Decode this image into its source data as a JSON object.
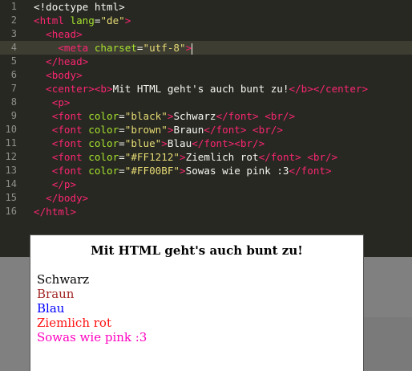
{
  "editor": {
    "lines": [
      {
        "n": "1",
        "segments": [
          {
            "c": "txt",
            "t": "<!doctype html>"
          }
        ]
      },
      {
        "n": "2",
        "segments": [
          {
            "c": "tag",
            "t": "<html "
          },
          {
            "c": "attr",
            "t": "lang"
          },
          {
            "c": "txt",
            "t": "="
          },
          {
            "c": "str",
            "t": "\"de\""
          },
          {
            "c": "tag",
            "t": ">"
          }
        ]
      },
      {
        "n": "3",
        "segments": [
          {
            "c": "txt",
            "t": "  "
          },
          {
            "c": "tag",
            "t": "<head>"
          }
        ]
      },
      {
        "n": "4",
        "segments": [
          {
            "c": "txt",
            "t": "    "
          },
          {
            "c": "tag",
            "t": "<meta "
          },
          {
            "c": "attr",
            "t": "charset"
          },
          {
            "c": "txt",
            "t": "="
          },
          {
            "c": "str",
            "t": "\"utf-8\""
          },
          {
            "c": "tag",
            "t": ">"
          }
        ],
        "active": true
      },
      {
        "n": "5",
        "segments": [
          {
            "c": "txt",
            "t": "  "
          },
          {
            "c": "tag",
            "t": "</head>"
          }
        ]
      },
      {
        "n": "6",
        "segments": [
          {
            "c": "txt",
            "t": "  "
          },
          {
            "c": "tag",
            "t": "<body>"
          }
        ]
      },
      {
        "n": "7",
        "segments": [
          {
            "c": "txt",
            "t": "  "
          },
          {
            "c": "tag",
            "t": "<center>"
          },
          {
            "c": "tag",
            "t": "<b>"
          },
          {
            "c": "txt",
            "t": "Mit HTML geht's auch bunt zu!"
          },
          {
            "c": "tag",
            "t": "</b>"
          },
          {
            "c": "tag",
            "t": "</center>"
          }
        ]
      },
      {
        "n": "8",
        "segments": [
          {
            "c": "txt",
            "t": "   "
          },
          {
            "c": "tag",
            "t": "<p>"
          }
        ]
      },
      {
        "n": "9",
        "segments": [
          {
            "c": "txt",
            "t": "   "
          },
          {
            "c": "tag",
            "t": "<font "
          },
          {
            "c": "attr",
            "t": "color"
          },
          {
            "c": "txt",
            "t": "="
          },
          {
            "c": "str",
            "t": "\"black\""
          },
          {
            "c": "tag",
            "t": ">"
          },
          {
            "c": "txt",
            "t": "Schwarz"
          },
          {
            "c": "tag",
            "t": "</font>"
          },
          {
            "c": "txt",
            "t": " "
          },
          {
            "c": "tag",
            "t": "<br/>"
          }
        ]
      },
      {
        "n": "10",
        "segments": [
          {
            "c": "txt",
            "t": "   "
          },
          {
            "c": "tag",
            "t": "<font "
          },
          {
            "c": "attr",
            "t": "color"
          },
          {
            "c": "txt",
            "t": "="
          },
          {
            "c": "str",
            "t": "\"brown\""
          },
          {
            "c": "tag",
            "t": ">"
          },
          {
            "c": "txt",
            "t": "Braun"
          },
          {
            "c": "tag",
            "t": "</font>"
          },
          {
            "c": "txt",
            "t": " "
          },
          {
            "c": "tag",
            "t": "<br/>"
          }
        ]
      },
      {
        "n": "11",
        "segments": [
          {
            "c": "txt",
            "t": "   "
          },
          {
            "c": "tag",
            "t": "<font "
          },
          {
            "c": "attr",
            "t": "color"
          },
          {
            "c": "txt",
            "t": "="
          },
          {
            "c": "str",
            "t": "\"blue\""
          },
          {
            "c": "tag",
            "t": ">"
          },
          {
            "c": "txt",
            "t": "Blau"
          },
          {
            "c": "tag",
            "t": "</font>"
          },
          {
            "c": "tag",
            "t": "<br/>"
          }
        ]
      },
      {
        "n": "12",
        "segments": [
          {
            "c": "txt",
            "t": "   "
          },
          {
            "c": "tag",
            "t": "<font "
          },
          {
            "c": "attr",
            "t": "color"
          },
          {
            "c": "txt",
            "t": "="
          },
          {
            "c": "str",
            "t": "\"#FF1212\""
          },
          {
            "c": "tag",
            "t": ">"
          },
          {
            "c": "txt",
            "t": "Ziemlich rot"
          },
          {
            "c": "tag",
            "t": "</font>"
          },
          {
            "c": "txt",
            "t": " "
          },
          {
            "c": "tag",
            "t": "<br/>"
          }
        ]
      },
      {
        "n": "13",
        "segments": [
          {
            "c": "txt",
            "t": "   "
          },
          {
            "c": "tag",
            "t": "<font "
          },
          {
            "c": "attr",
            "t": "color"
          },
          {
            "c": "txt",
            "t": "="
          },
          {
            "c": "str",
            "t": "\"#FF00BF\""
          },
          {
            "c": "tag",
            "t": ">"
          },
          {
            "c": "txt",
            "t": "Sowas wie pink :3"
          },
          {
            "c": "tag",
            "t": "</font>"
          }
        ]
      },
      {
        "n": "14",
        "segments": [
          {
            "c": "txt",
            "t": "   "
          },
          {
            "c": "tag",
            "t": "</p>"
          }
        ]
      },
      {
        "n": "15",
        "segments": [
          {
            "c": "txt",
            "t": "  "
          },
          {
            "c": "tag",
            "t": "</body>"
          }
        ]
      },
      {
        "n": "16",
        "segments": [
          {
            "c": "tag",
            "t": "</html>"
          }
        ]
      }
    ]
  },
  "preview": {
    "title": "Mit HTML geht's auch bunt zu!",
    "items": [
      {
        "text": "Schwarz",
        "color": "#000000"
      },
      {
        "text": "Braun",
        "color": "#a52a2a"
      },
      {
        "text": "Blau",
        "color": "#0000ff"
      },
      {
        "text": "Ziemlich rot",
        "color": "#ff1212"
      },
      {
        "text": "Sowas wie pink :3",
        "color": "#ff00bf"
      }
    ]
  }
}
